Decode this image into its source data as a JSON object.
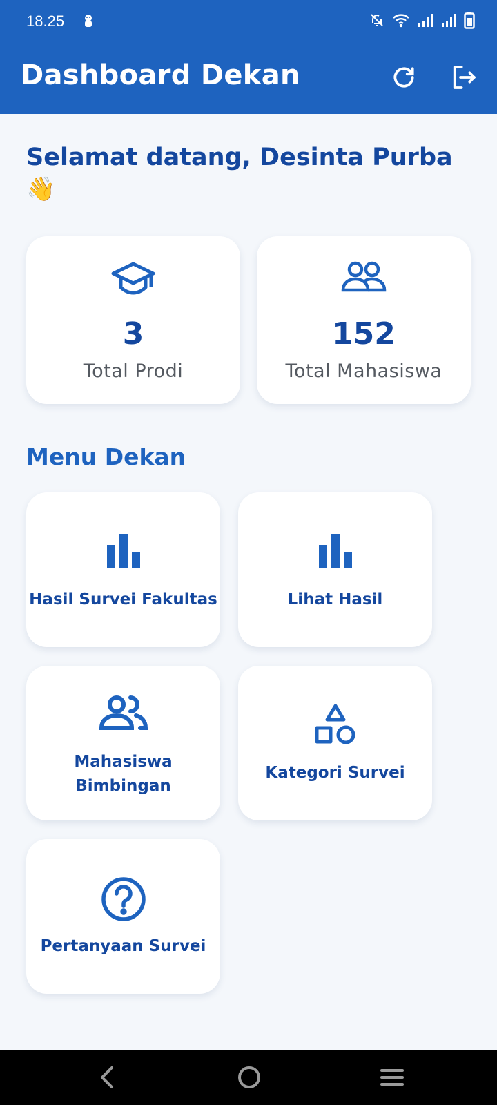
{
  "status_bar": {
    "time": "18.25"
  },
  "app_bar": {
    "title": "Dashboard Dekan",
    "refresh_icon": "refresh-icon",
    "logout_icon": "logout-icon"
  },
  "welcome": {
    "text": "Selamat datang, Desinta Purba",
    "emoji": "👋"
  },
  "stats": [
    {
      "icon": "graduation-cap-icon",
      "value": "3",
      "label": "Total Prodi"
    },
    {
      "icon": "people-icon",
      "value": "152",
      "label": "Total Mahasiswa"
    }
  ],
  "menu": {
    "title": "Menu Dekan",
    "items": [
      {
        "icon": "bar-chart-icon",
        "label": "Hasil Survei Fakultas"
      },
      {
        "icon": "bar-chart-icon",
        "label": "Lihat Hasil"
      },
      {
        "icon": "people-icon",
        "label": "Mahasiswa Bimbingan"
      },
      {
        "icon": "shapes-icon",
        "label": "Kategori Survei"
      },
      {
        "icon": "question-icon",
        "label": "Pertanyaan Survei"
      }
    ]
  },
  "colors": {
    "primary": "#1e63bf",
    "primary_dark": "#14479e",
    "background": "#f4f7fb"
  }
}
